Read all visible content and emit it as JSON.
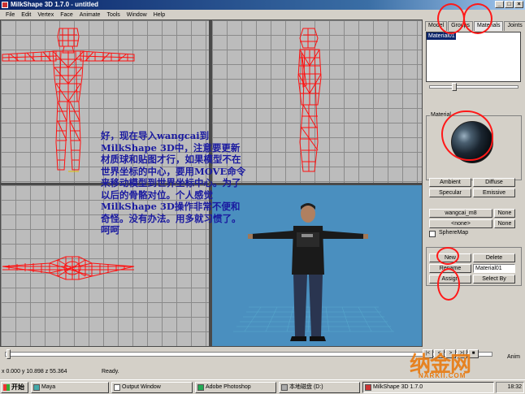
{
  "window": {
    "title": "MilkShape 3D 1.7.0 - untitled"
  },
  "window_buttons": [
    "_",
    "□",
    "×"
  ],
  "menu": [
    "File",
    "Edit",
    "Vertex",
    "Face",
    "Animate",
    "Tools",
    "Window",
    "Help"
  ],
  "overlay_text": "好，现在导入wangcai到MilkShape 3D中，注意要更新材质球和贴图才行，如果模型不在世界坐标的中心，要用MOVE命令来移动模型到世界坐标中心。为了以后的骨骼对位。个人感觉MilkShape 3D操作非常不便和奇怪。没有办法。用多就习惯了。呵呵",
  "panel": {
    "tabs": [
      "Model",
      "Groups",
      "Materials",
      "Joints"
    ],
    "material_list": [
      "Material01"
    ],
    "material_group_label": "Material",
    "ambient": "Ambient",
    "diffuse": "Diffuse",
    "specular": "Specular",
    "emissive": "Emissive",
    "texture1": "wangcai_m8",
    "texture2": "<none>",
    "none_btn": "None",
    "spheremap": "SphereMap",
    "new_btn": "New",
    "delete_btn": "Delete",
    "rename_btn": "Rename",
    "name_value": "Material01",
    "assign_btn": "Assign",
    "selectby_btn": "Select By"
  },
  "timeline": {
    "anim_label": "Anim",
    "controls": [
      "|<",
      "<",
      ">",
      ">|",
      "■"
    ]
  },
  "status": {
    "coords": "x 0.000 y 10.898 z 55.364",
    "text": "Ready."
  },
  "taskbar": {
    "start": "开始",
    "items": [
      "Maya",
      "Output Window",
      "Adobe Photoshop",
      "本地磁盘 (D:)",
      "MilkShape 3D 1.7.0"
    ],
    "clock": "18:32"
  },
  "watermark": {
    "main": "纳金网",
    "sub": "NARKII.COM"
  },
  "colors": {
    "wire": "#ff1010",
    "viewport_gray": "#bcbcbc",
    "viewport_3d": "#4a8fbf",
    "annotation": "#ff1818",
    "overlay": "#1a1aa0"
  }
}
